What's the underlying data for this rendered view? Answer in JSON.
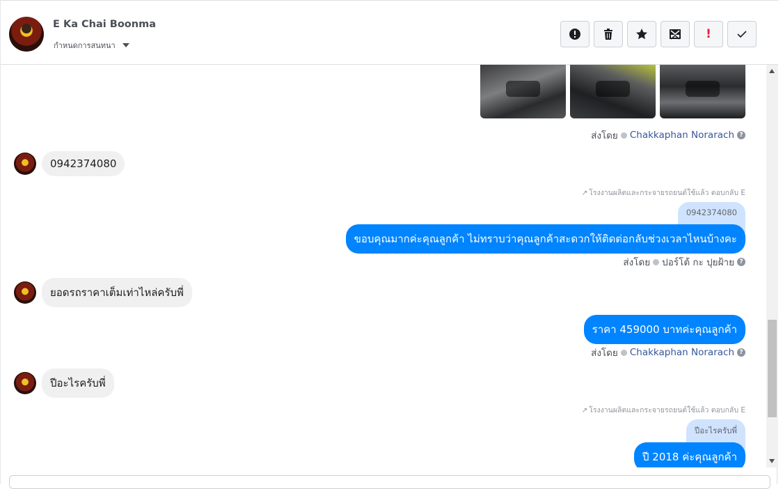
{
  "header": {
    "contact_name": "E Ka Chai Boonma",
    "convo_setting": "กำหนดการสนทนา",
    "toolbar": [
      {
        "icon": "alert-circle-icon"
      },
      {
        "icon": "trash-icon"
      },
      {
        "icon": "star-icon"
      },
      {
        "icon": "mark-unread-icon"
      },
      {
        "icon": "follow-up-icon",
        "label": "!"
      },
      {
        "icon": "check-icon"
      }
    ]
  },
  "thread": {
    "photo_sentby": {
      "prefix": "ส่งโดย",
      "agent": "Chakkaphan Norarach"
    },
    "msg1": "0942374080",
    "reply1_note": "โรงงานผลิตและกระจายรถยนต์ใช้แล้ว ตอบกลับ E",
    "reply1_quote": "0942374080",
    "reply1_text": "ขอบคุณมากค่ะคุณลูกค้า ไม่ทราบว่าคุณลูกค้าสะดวกให้ติดต่อกลับช่วงเวลาไหนบ้างคะ",
    "reply1_sentby": {
      "prefix": "ส่งโดย",
      "agent": "ปอร์โต้ กะ ปุยฝ้าย"
    },
    "msg2": "ยอดรถราคาเต็มเท่าไหล่ครับพี่",
    "reply2_text": "ราคา 459000 บาทค่ะคุณลูกค้า",
    "reply2_sentby": {
      "prefix": "ส่งโดย",
      "agent": "Chakkaphan Norarach"
    },
    "msg3": "ปีอะไรครับพี่",
    "reply3_note": "โรงงานผลิตและกระจายรถยนต์ใช้แล้ว ตอบกลับ E",
    "reply3_quote": "ปีอะไรครับพี่",
    "reply3_text": "ปี 2018 ค่ะคุณลูกค้า"
  },
  "colors": {
    "accent": "#0084ff",
    "incoming": "#f1f0f0",
    "quote": "#cfe3fe",
    "link": "#365899"
  }
}
